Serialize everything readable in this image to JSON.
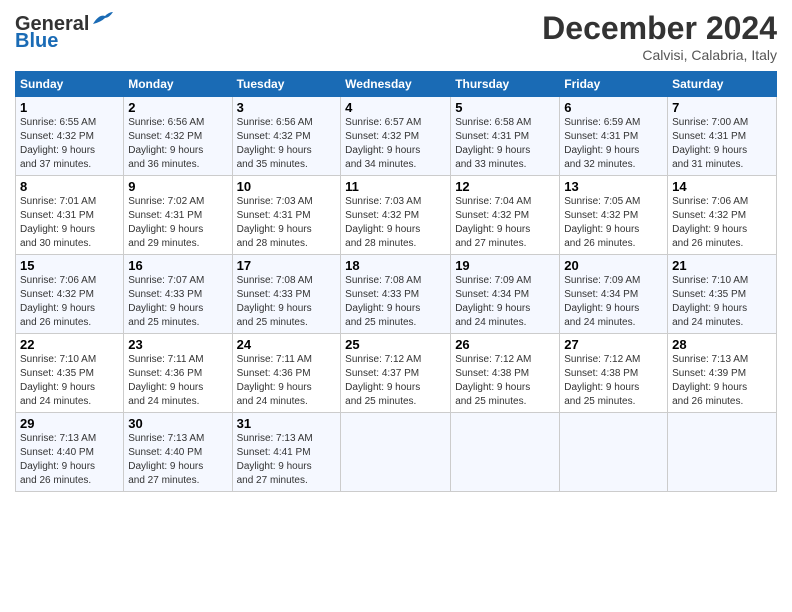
{
  "header": {
    "logo_line1": "General",
    "logo_line2": "Blue",
    "month": "December 2024",
    "location": "Calvisi, Calabria, Italy"
  },
  "days_of_week": [
    "Sunday",
    "Monday",
    "Tuesday",
    "Wednesday",
    "Thursday",
    "Friday",
    "Saturday"
  ],
  "weeks": [
    [
      {
        "day": "1",
        "info": "Sunrise: 6:55 AM\nSunset: 4:32 PM\nDaylight: 9 hours\nand 37 minutes."
      },
      {
        "day": "2",
        "info": "Sunrise: 6:56 AM\nSunset: 4:32 PM\nDaylight: 9 hours\nand 36 minutes."
      },
      {
        "day": "3",
        "info": "Sunrise: 6:56 AM\nSunset: 4:32 PM\nDaylight: 9 hours\nand 35 minutes."
      },
      {
        "day": "4",
        "info": "Sunrise: 6:57 AM\nSunset: 4:32 PM\nDaylight: 9 hours\nand 34 minutes."
      },
      {
        "day": "5",
        "info": "Sunrise: 6:58 AM\nSunset: 4:31 PM\nDaylight: 9 hours\nand 33 minutes."
      },
      {
        "day": "6",
        "info": "Sunrise: 6:59 AM\nSunset: 4:31 PM\nDaylight: 9 hours\nand 32 minutes."
      },
      {
        "day": "7",
        "info": "Sunrise: 7:00 AM\nSunset: 4:31 PM\nDaylight: 9 hours\nand 31 minutes."
      }
    ],
    [
      {
        "day": "8",
        "info": "Sunrise: 7:01 AM\nSunset: 4:31 PM\nDaylight: 9 hours\nand 30 minutes."
      },
      {
        "day": "9",
        "info": "Sunrise: 7:02 AM\nSunset: 4:31 PM\nDaylight: 9 hours\nand 29 minutes."
      },
      {
        "day": "10",
        "info": "Sunrise: 7:03 AM\nSunset: 4:31 PM\nDaylight: 9 hours\nand 28 minutes."
      },
      {
        "day": "11",
        "info": "Sunrise: 7:03 AM\nSunset: 4:32 PM\nDaylight: 9 hours\nand 28 minutes."
      },
      {
        "day": "12",
        "info": "Sunrise: 7:04 AM\nSunset: 4:32 PM\nDaylight: 9 hours\nand 27 minutes."
      },
      {
        "day": "13",
        "info": "Sunrise: 7:05 AM\nSunset: 4:32 PM\nDaylight: 9 hours\nand 26 minutes."
      },
      {
        "day": "14",
        "info": "Sunrise: 7:06 AM\nSunset: 4:32 PM\nDaylight: 9 hours\nand 26 minutes."
      }
    ],
    [
      {
        "day": "15",
        "info": "Sunrise: 7:06 AM\nSunset: 4:32 PM\nDaylight: 9 hours\nand 26 minutes."
      },
      {
        "day": "16",
        "info": "Sunrise: 7:07 AM\nSunset: 4:33 PM\nDaylight: 9 hours\nand 25 minutes."
      },
      {
        "day": "17",
        "info": "Sunrise: 7:08 AM\nSunset: 4:33 PM\nDaylight: 9 hours\nand 25 minutes."
      },
      {
        "day": "18",
        "info": "Sunrise: 7:08 AM\nSunset: 4:33 PM\nDaylight: 9 hours\nand 25 minutes."
      },
      {
        "day": "19",
        "info": "Sunrise: 7:09 AM\nSunset: 4:34 PM\nDaylight: 9 hours\nand 24 minutes."
      },
      {
        "day": "20",
        "info": "Sunrise: 7:09 AM\nSunset: 4:34 PM\nDaylight: 9 hours\nand 24 minutes."
      },
      {
        "day": "21",
        "info": "Sunrise: 7:10 AM\nSunset: 4:35 PM\nDaylight: 9 hours\nand 24 minutes."
      }
    ],
    [
      {
        "day": "22",
        "info": "Sunrise: 7:10 AM\nSunset: 4:35 PM\nDaylight: 9 hours\nand 24 minutes."
      },
      {
        "day": "23",
        "info": "Sunrise: 7:11 AM\nSunset: 4:36 PM\nDaylight: 9 hours\nand 24 minutes."
      },
      {
        "day": "24",
        "info": "Sunrise: 7:11 AM\nSunset: 4:36 PM\nDaylight: 9 hours\nand 24 minutes."
      },
      {
        "day": "25",
        "info": "Sunrise: 7:12 AM\nSunset: 4:37 PM\nDaylight: 9 hours\nand 25 minutes."
      },
      {
        "day": "26",
        "info": "Sunrise: 7:12 AM\nSunset: 4:38 PM\nDaylight: 9 hours\nand 25 minutes."
      },
      {
        "day": "27",
        "info": "Sunrise: 7:12 AM\nSunset: 4:38 PM\nDaylight: 9 hours\nand 25 minutes."
      },
      {
        "day": "28",
        "info": "Sunrise: 7:13 AM\nSunset: 4:39 PM\nDaylight: 9 hours\nand 26 minutes."
      }
    ],
    [
      {
        "day": "29",
        "info": "Sunrise: 7:13 AM\nSunset: 4:40 PM\nDaylight: 9 hours\nand 26 minutes."
      },
      {
        "day": "30",
        "info": "Sunrise: 7:13 AM\nSunset: 4:40 PM\nDaylight: 9 hours\nand 27 minutes."
      },
      {
        "day": "31",
        "info": "Sunrise: 7:13 AM\nSunset: 4:41 PM\nDaylight: 9 hours\nand 27 minutes."
      },
      null,
      null,
      null,
      null
    ]
  ]
}
